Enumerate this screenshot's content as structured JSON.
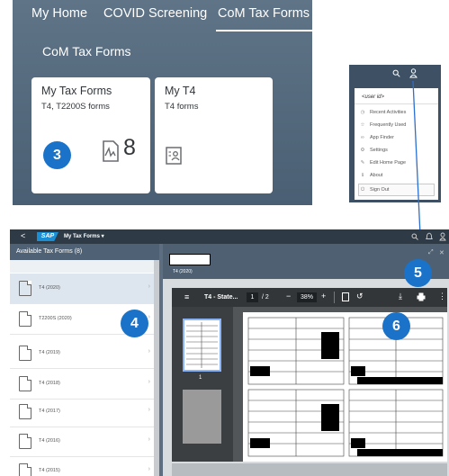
{
  "top": {
    "tabs": [
      "My Home",
      "COVID Screening",
      "CoM Tax Forms"
    ],
    "section_title": "CoM Tax Forms",
    "tiles": [
      {
        "title": "My Tax Forms",
        "subtitle": "T4, T2200S forms",
        "count": "8",
        "icon": "document-signature-icon"
      },
      {
        "title": "My T4",
        "subtitle": "T4 forms",
        "icon": "user-document-icon"
      }
    ],
    "callout": "3"
  },
  "user_menu": {
    "header": "<user id>",
    "items": [
      {
        "label": "Recent Activities",
        "icon": "history-icon"
      },
      {
        "label": "Frequently Used",
        "icon": "star-icon"
      },
      {
        "label": "App Finder",
        "icon": "binoculars-icon"
      },
      {
        "label": "Settings",
        "icon": "gear-icon"
      },
      {
        "label": "Edit Home Page",
        "icon": "pencil-icon"
      },
      {
        "label": "About",
        "icon": "info-icon"
      },
      {
        "label": "Sign Out",
        "icon": "sign-out-icon"
      }
    ]
  },
  "app": {
    "back": "<",
    "brand": "SAP",
    "title": "My Tax Forms ▾",
    "list_header": "Available Tax Forms (8)",
    "forms": [
      "T4 (2020)",
      "T2200S (2020)",
      "T4 (2019)",
      "T4 (2018)",
      "T4 (2017)",
      "T4 (2016)",
      "T4 (2015)"
    ],
    "detail_subtitle": "T4 (2020)",
    "pdf": {
      "filename": "T4 - State...",
      "page": "1",
      "pages": "/ 2",
      "zoom": "38%",
      "thumb_page": "1"
    },
    "callouts": [
      "4",
      "5",
      "6"
    ]
  },
  "colors": {
    "accent": "#1a73c8",
    "shell": "#2e3b47"
  }
}
